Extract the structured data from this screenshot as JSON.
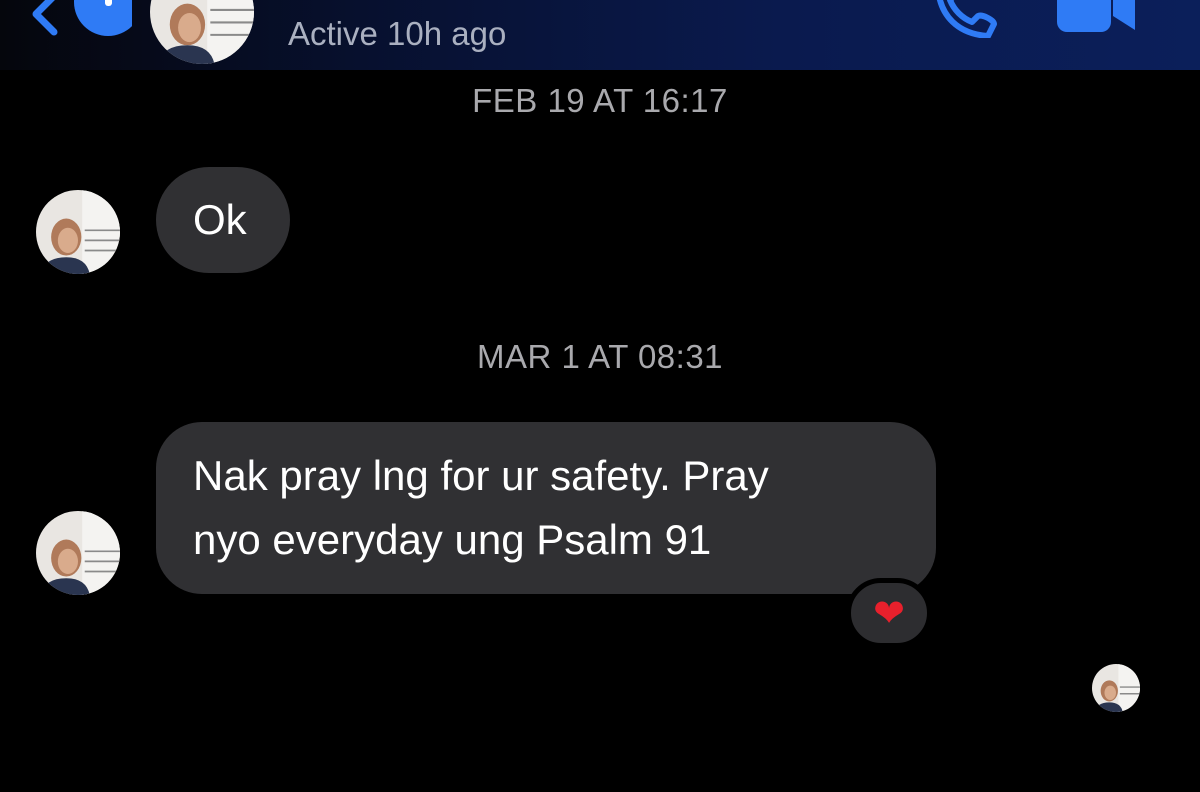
{
  "header": {
    "contact_name": "",
    "active_status": "Active 10h ago",
    "back_icon": "chevron-left-icon",
    "call_icon": "phone-icon",
    "video_icon": "video-camera-icon",
    "accent_color": "#1d6cf2"
  },
  "conversation": [
    {
      "timestamp": "FEB 19 AT 16:17",
      "message": {
        "sender": "contact",
        "text": "Ok"
      }
    },
    {
      "timestamp": "MAR 1 AT 08:31",
      "message": {
        "sender": "contact",
        "text_lines": [
          "Nak pray lng for ur safety. Pray",
          "nyo everyday ung Psalm 91"
        ],
        "reaction": "❤"
      }
    }
  ],
  "colors": {
    "background": "#000000",
    "bubble": "#303033",
    "timestamp": "#a9a9ad",
    "status": "#aab0c0"
  }
}
